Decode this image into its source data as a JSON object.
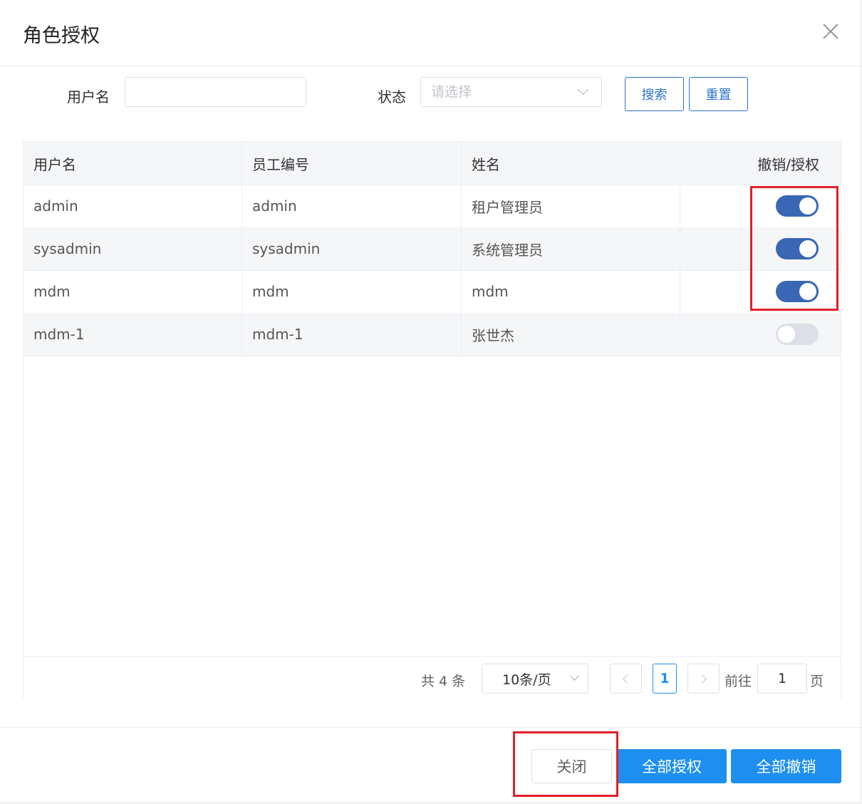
{
  "dialog": {
    "title": "角色授权"
  },
  "filters": {
    "username_label": "用户名",
    "username_value": "",
    "status_label": "状态",
    "status_placeholder": "请选择",
    "search_label": "搜索",
    "reset_label": "重置"
  },
  "table": {
    "headers": [
      "用户名",
      "员工编号",
      "姓名",
      "撤销/授权"
    ],
    "rows": [
      {
        "username": "admin",
        "employee_no": "admin",
        "name": "租户管理员",
        "authorized": true
      },
      {
        "username": "sysadmin",
        "employee_no": "sysadmin",
        "name": "系统管理员",
        "authorized": true
      },
      {
        "username": "mdm",
        "employee_no": "mdm",
        "name": "mdm",
        "authorized": true
      },
      {
        "username": "mdm-1",
        "employee_no": "mdm-1",
        "name": "张世杰",
        "authorized": false
      }
    ]
  },
  "pagination": {
    "total_text": "共 4 条",
    "page_size": "10条/页",
    "current_page": "1",
    "goto_label": "前往",
    "goto_value": "1",
    "page_suffix": "页"
  },
  "footer": {
    "close_label": "关闭",
    "grant_all_label": "全部授权",
    "revoke_all_label": "全部撤销"
  },
  "colors": {
    "switch_on": "#3a67b4",
    "switch_off": "#dcdfe6",
    "primary": "#1e8ff0",
    "highlight": "#e0202a"
  }
}
